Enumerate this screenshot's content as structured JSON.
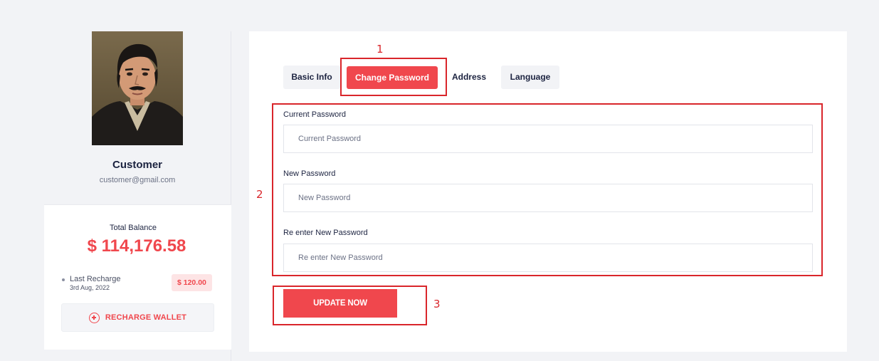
{
  "profile": {
    "name": "Customer",
    "email": "customer@gmail.com"
  },
  "wallet": {
    "balance_label": "Total Balance",
    "balance_amount": "$ 114,176.58",
    "last_recharge_label": "Last Recharge",
    "last_recharge_date": "3rd Aug, 2022",
    "last_recharge_amount": "$ 120.00",
    "recharge_button_label": "RECHARGE WALLET",
    "recharge_icon": "plus-circle-icon"
  },
  "tabs": [
    {
      "label": "Basic Info",
      "active": false
    },
    {
      "label": "Change Password",
      "active": true
    },
    {
      "label": "Address",
      "active": false
    },
    {
      "label": "Language",
      "active": false
    }
  ],
  "form": {
    "current_password": {
      "label": "Current Password",
      "placeholder": "Current Password",
      "value": ""
    },
    "new_password": {
      "label": "New Password",
      "placeholder": "New Password",
      "value": ""
    },
    "reenter_password": {
      "label": "Re enter New Password",
      "placeholder": "Re enter New Password",
      "value": ""
    },
    "submit_label": "UPDATE NOW"
  },
  "annotations": [
    "1",
    "2",
    "3"
  ],
  "colors": {
    "accent": "#f0474d",
    "annotation": "#d9262b",
    "background": "#f2f3f6"
  }
}
